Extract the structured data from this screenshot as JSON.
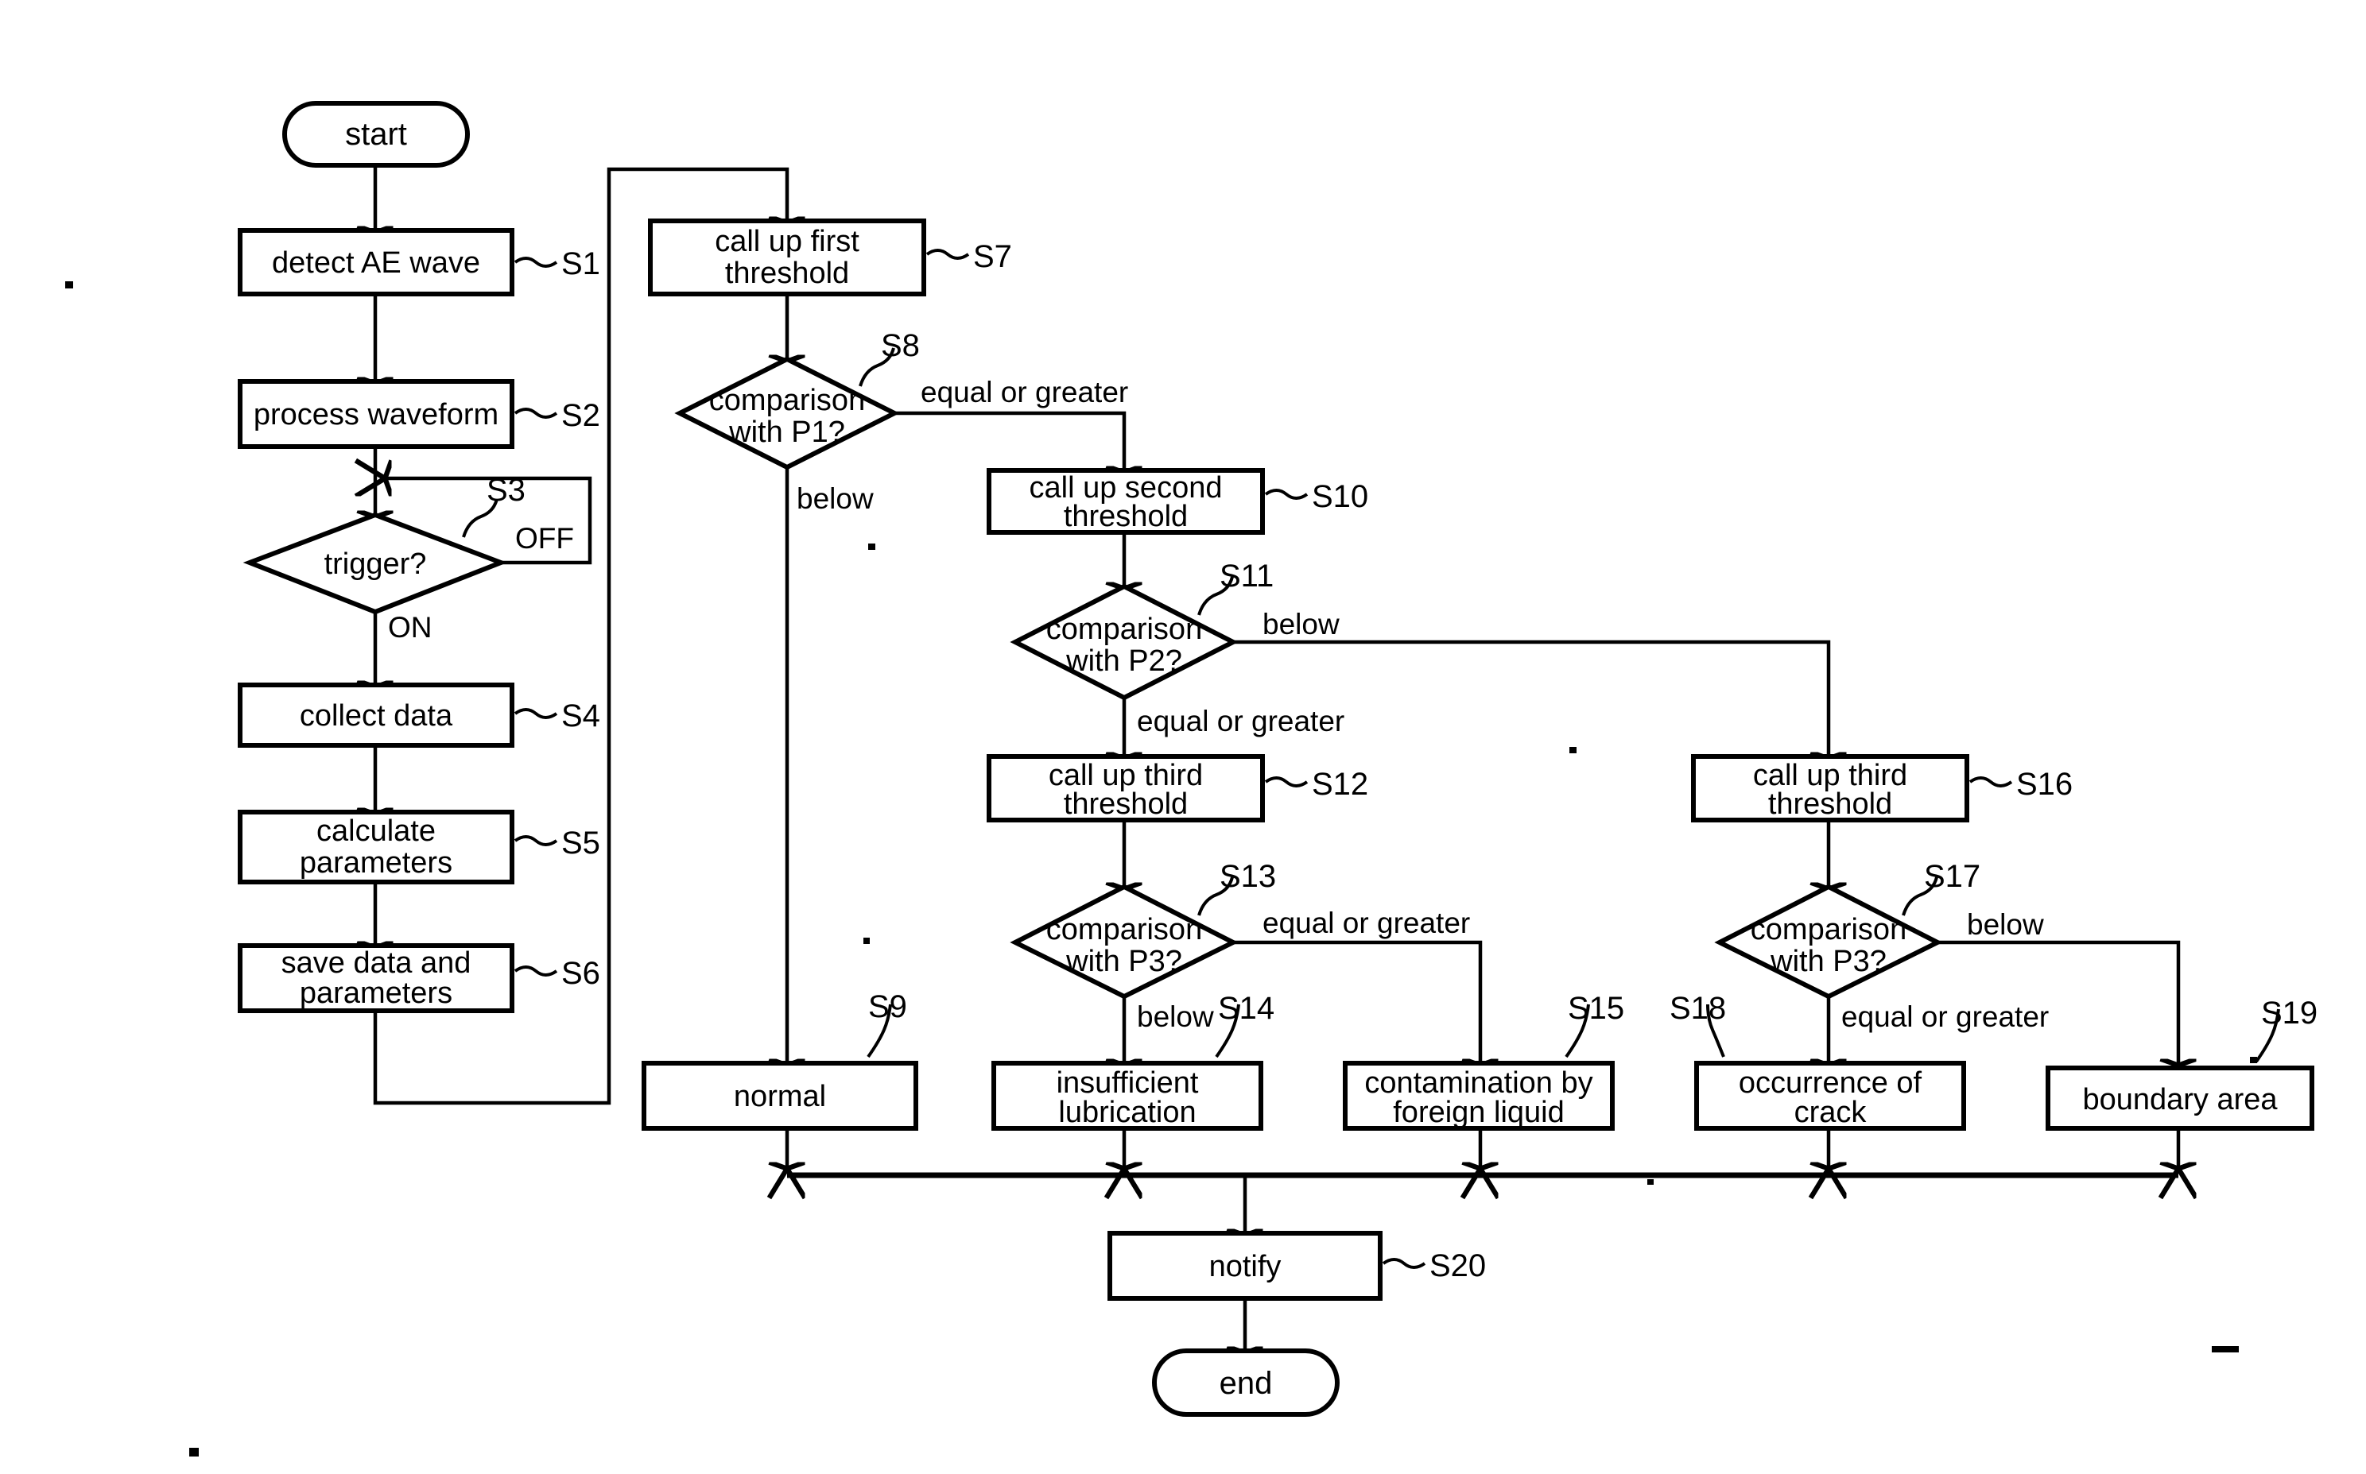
{
  "diagram": {
    "title": "AE wave diagnosis flowchart",
    "terminals": {
      "start": "start",
      "end": "end"
    },
    "nodes": [
      {
        "id": "S1",
        "label": "detect AE wave",
        "step": "S1",
        "type": "process"
      },
      {
        "id": "S2",
        "label": "process waveform",
        "step": "S2",
        "type": "process"
      },
      {
        "id": "S3",
        "label": "trigger?",
        "step": "S3",
        "type": "decision"
      },
      {
        "id": "S4",
        "label": "collect data",
        "step": "S4",
        "type": "process"
      },
      {
        "id": "S5",
        "label": "calculate parameters",
        "step": "S5",
        "type": "process",
        "lines": [
          "calculate",
          "parameters"
        ]
      },
      {
        "id": "S6",
        "label": "save data and parameters",
        "step": "S6",
        "type": "process",
        "lines": [
          "save data and",
          "parameters"
        ]
      },
      {
        "id": "S7",
        "label": "call up first threshold",
        "step": "S7",
        "type": "process",
        "lines": [
          "call up first",
          "threshold"
        ]
      },
      {
        "id": "S8",
        "label": "comparison with P1?",
        "step": "S8",
        "type": "decision",
        "lines": [
          "comparison",
          "with P1?"
        ]
      },
      {
        "id": "S9",
        "label": "normal",
        "step": "S9",
        "type": "result"
      },
      {
        "id": "S10",
        "label": "call up second threshold",
        "step": "S10",
        "type": "process",
        "lines": [
          "call up second",
          "threshold"
        ]
      },
      {
        "id": "S11",
        "label": "comparison with P2?",
        "step": "S11",
        "type": "decision",
        "lines": [
          "comparison",
          "with P2?"
        ]
      },
      {
        "id": "S12",
        "label": "call up third threshold",
        "step": "S12",
        "type": "process",
        "lines": [
          "call up third",
          "threshold"
        ]
      },
      {
        "id": "S13",
        "label": "comparison with P3?",
        "step": "S13",
        "type": "decision",
        "lines": [
          "comparison",
          "with P3?"
        ]
      },
      {
        "id": "S14",
        "label": "insufficient lubrication",
        "step": "S14",
        "type": "result",
        "lines": [
          "insufficient",
          "lubrication"
        ]
      },
      {
        "id": "S15",
        "label": "contamination by foreign liquid",
        "step": "S15",
        "type": "result",
        "lines": [
          "contamination by",
          "foreign liquid"
        ]
      },
      {
        "id": "S16",
        "label": "call up third threshold",
        "step": "S16",
        "type": "process",
        "lines": [
          "call up third",
          "threshold"
        ]
      },
      {
        "id": "S17",
        "label": "comparison with P3?",
        "step": "S17",
        "type": "decision",
        "lines": [
          "comparison",
          "with P3?"
        ]
      },
      {
        "id": "S18",
        "label": "occurrence of crack",
        "step": "S18",
        "type": "result",
        "lines": [
          "occurrence of",
          "crack"
        ]
      },
      {
        "id": "S19",
        "label": "boundary area",
        "step": "S19",
        "type": "result"
      },
      {
        "id": "S20",
        "label": "notify",
        "step": "S20",
        "type": "process"
      }
    ],
    "edge_labels": {
      "s3_off": "OFF",
      "s3_on": "ON",
      "s8_equal_or_greater": "equal or greater",
      "s8_below": "below",
      "s11_below": "below",
      "s11_equal_or_greater": "equal or greater",
      "s13_equal_or_greater": "equal or greater",
      "s13_below": "below",
      "s17_below": "below",
      "s17_equal_or_greater": "equal or greater"
    },
    "step_labels": {
      "S1": "S1",
      "S2": "S2",
      "S3": "S3",
      "S4": "S4",
      "S5": "S5",
      "S6": "S6",
      "S7": "S7",
      "S8": "S8",
      "S9": "S9",
      "S10": "S10",
      "S11": "S11",
      "S12": "S12",
      "S13": "S13",
      "S14": "S14",
      "S15": "S15",
      "S16": "S16",
      "S17": "S17",
      "S18": "S18",
      "S19": "S19",
      "S20": "S20"
    },
    "colors": {
      "line": "#000000",
      "fill": "#ffffff",
      "text": "#000000"
    }
  }
}
